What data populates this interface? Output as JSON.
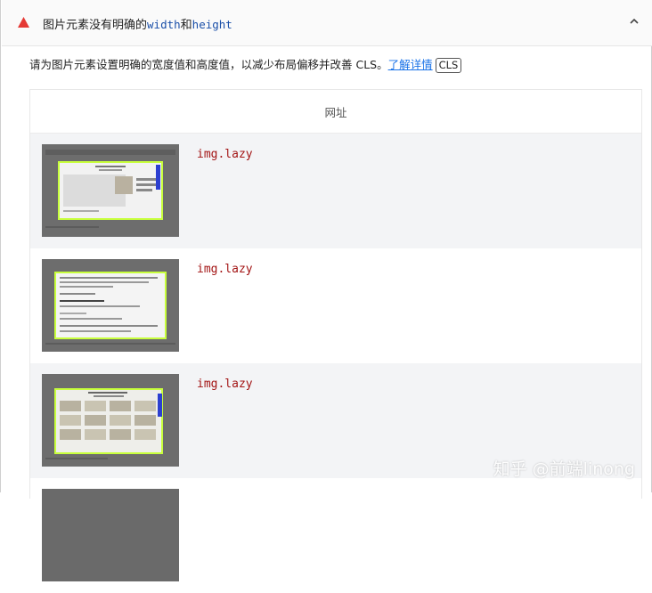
{
  "audit": {
    "title_prefix": "图片元素没有明确的",
    "code_width": "width",
    "title_middle": "和",
    "code_height": "height"
  },
  "description": {
    "text": "请为图片元素设置明确的宽度值和高度值，以减少布局偏移并改善 CLS。",
    "link": "了解详情",
    "badge": "CLS"
  },
  "table": {
    "header": "网址",
    "rows": [
      {
        "node": "img.lazy"
      },
      {
        "node": "img.lazy"
      },
      {
        "node": "img.lazy"
      }
    ]
  },
  "watermark": "知乎 @前端linong",
  "colors": {
    "warning": "#e53935",
    "link": "#1a73e8",
    "code_blue": "#1a4fa8",
    "node_red": "#a31515"
  }
}
